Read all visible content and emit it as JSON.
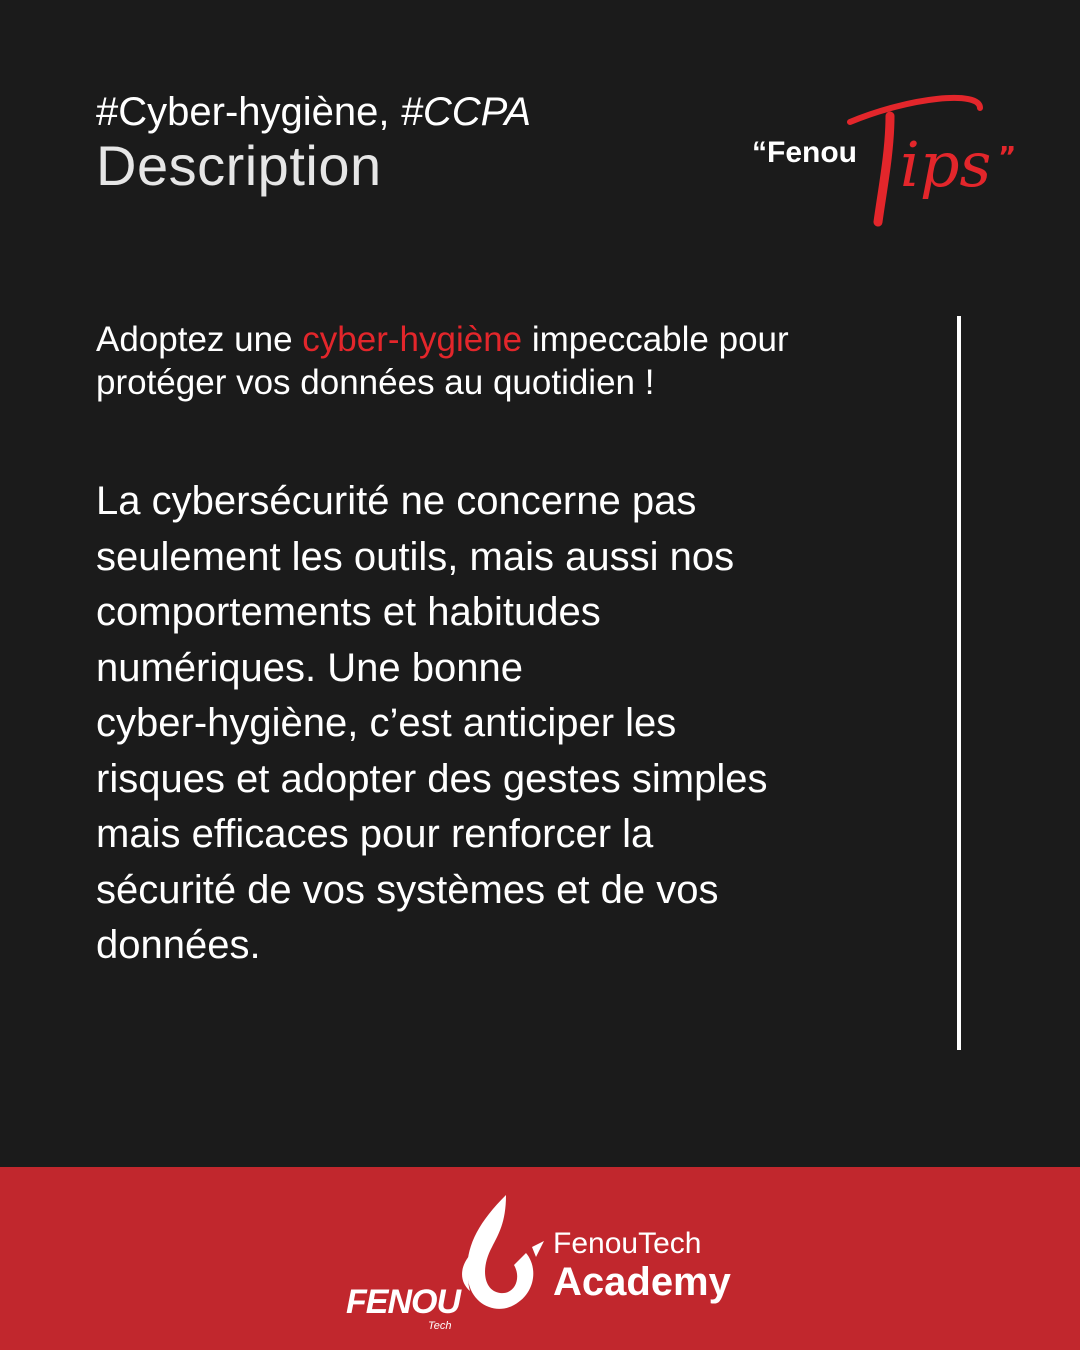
{
  "header": {
    "hashtag_1": "#Cyber-hygiène,",
    "hashtag_2": "#CCPA",
    "title": "Description"
  },
  "tips_logo": {
    "prefix": "“Fenou",
    "script_word": "Tips",
    "closing_mark": "”"
  },
  "intro": {
    "before": "Adoptez une ",
    "highlight": "cyber-hygiène",
    "after": " impeccable pour protéger vos données au quotidien !"
  },
  "body": {
    "lines": [
      "La cybersécurité ne concerne pas",
      "seulement les outils, mais aussi nos",
      "comportements et habitudes",
      "numériques. Une bonne",
      "cyber-hygiène, c’est anticiper les",
      "risques et adopter des gestes simples",
      "mais efficaces pour renforcer la",
      "sécurité de vos systèmes et de vos",
      "données."
    ]
  },
  "footer": {
    "brand_logo_text": "FENOU",
    "brand_logo_sub": "Tech",
    "org_line1": "FenouTech",
    "org_line2": "Academy"
  },
  "colors": {
    "background": "#1b1b1b",
    "accent": "#e3262b",
    "footer_band": "#c1272d",
    "text": "#ffffff"
  },
  "icons": {
    "brand_mark": "flame-logo-icon"
  }
}
